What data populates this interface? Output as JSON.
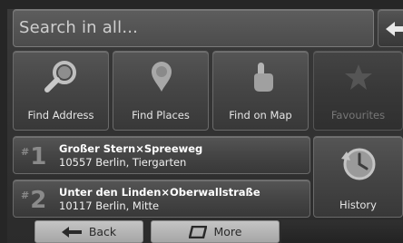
{
  "search": {
    "placeholder": "Search in all..."
  },
  "menu": [
    {
      "label": "Find Address",
      "icon": "magnifier-icon",
      "enabled": true
    },
    {
      "label": "Find Places",
      "icon": "map-pin-icon",
      "enabled": true
    },
    {
      "label": "Find on Map",
      "icon": "pointing-hand-icon",
      "enabled": true
    },
    {
      "label": "Favourites",
      "icon": "star-icon",
      "enabled": false
    }
  ],
  "recent": [
    {
      "index": "1",
      "name": "Großer Stern×Spreeweg",
      "address": "10557 Berlin, Tiergarten"
    },
    {
      "index": "2",
      "name": "Unter den Linden×Oberwallstraße",
      "address": "10117 Berlin, Mitte"
    }
  ],
  "history": {
    "label": "History",
    "icon": "history-clock-icon"
  },
  "footer": {
    "back_label": "Back",
    "more_label": "More"
  },
  "colors": {
    "background": "#262626",
    "tile": "#464646",
    "footer_button": "#b5b5b5"
  }
}
